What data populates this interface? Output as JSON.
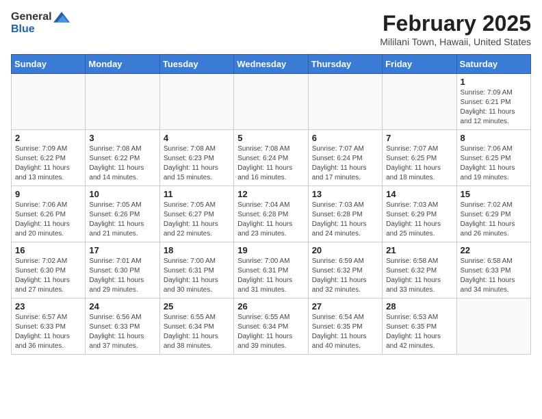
{
  "logo": {
    "general": "General",
    "blue": "Blue"
  },
  "header": {
    "month_year": "February 2025",
    "location": "Mililani Town, Hawaii, United States"
  },
  "days_of_week": [
    "Sunday",
    "Monday",
    "Tuesday",
    "Wednesday",
    "Thursday",
    "Friday",
    "Saturday"
  ],
  "weeks": [
    [
      {
        "day": "",
        "info": ""
      },
      {
        "day": "",
        "info": ""
      },
      {
        "day": "",
        "info": ""
      },
      {
        "day": "",
        "info": ""
      },
      {
        "day": "",
        "info": ""
      },
      {
        "day": "",
        "info": ""
      },
      {
        "day": "1",
        "info": "Sunrise: 7:09 AM\nSunset: 6:21 PM\nDaylight: 11 hours and 12 minutes."
      }
    ],
    [
      {
        "day": "2",
        "info": "Sunrise: 7:09 AM\nSunset: 6:22 PM\nDaylight: 11 hours and 13 minutes."
      },
      {
        "day": "3",
        "info": "Sunrise: 7:08 AM\nSunset: 6:22 PM\nDaylight: 11 hours and 14 minutes."
      },
      {
        "day": "4",
        "info": "Sunrise: 7:08 AM\nSunset: 6:23 PM\nDaylight: 11 hours and 15 minutes."
      },
      {
        "day": "5",
        "info": "Sunrise: 7:08 AM\nSunset: 6:24 PM\nDaylight: 11 hours and 16 minutes."
      },
      {
        "day": "6",
        "info": "Sunrise: 7:07 AM\nSunset: 6:24 PM\nDaylight: 11 hours and 17 minutes."
      },
      {
        "day": "7",
        "info": "Sunrise: 7:07 AM\nSunset: 6:25 PM\nDaylight: 11 hours and 18 minutes."
      },
      {
        "day": "8",
        "info": "Sunrise: 7:06 AM\nSunset: 6:25 PM\nDaylight: 11 hours and 19 minutes."
      }
    ],
    [
      {
        "day": "9",
        "info": "Sunrise: 7:06 AM\nSunset: 6:26 PM\nDaylight: 11 hours and 20 minutes."
      },
      {
        "day": "10",
        "info": "Sunrise: 7:05 AM\nSunset: 6:26 PM\nDaylight: 11 hours and 21 minutes."
      },
      {
        "day": "11",
        "info": "Sunrise: 7:05 AM\nSunset: 6:27 PM\nDaylight: 11 hours and 22 minutes."
      },
      {
        "day": "12",
        "info": "Sunrise: 7:04 AM\nSunset: 6:28 PM\nDaylight: 11 hours and 23 minutes."
      },
      {
        "day": "13",
        "info": "Sunrise: 7:03 AM\nSunset: 6:28 PM\nDaylight: 11 hours and 24 minutes."
      },
      {
        "day": "14",
        "info": "Sunrise: 7:03 AM\nSunset: 6:29 PM\nDaylight: 11 hours and 25 minutes."
      },
      {
        "day": "15",
        "info": "Sunrise: 7:02 AM\nSunset: 6:29 PM\nDaylight: 11 hours and 26 minutes."
      }
    ],
    [
      {
        "day": "16",
        "info": "Sunrise: 7:02 AM\nSunset: 6:30 PM\nDaylight: 11 hours and 27 minutes."
      },
      {
        "day": "17",
        "info": "Sunrise: 7:01 AM\nSunset: 6:30 PM\nDaylight: 11 hours and 29 minutes."
      },
      {
        "day": "18",
        "info": "Sunrise: 7:00 AM\nSunset: 6:31 PM\nDaylight: 11 hours and 30 minutes."
      },
      {
        "day": "19",
        "info": "Sunrise: 7:00 AM\nSunset: 6:31 PM\nDaylight: 11 hours and 31 minutes."
      },
      {
        "day": "20",
        "info": "Sunrise: 6:59 AM\nSunset: 6:32 PM\nDaylight: 11 hours and 32 minutes."
      },
      {
        "day": "21",
        "info": "Sunrise: 6:58 AM\nSunset: 6:32 PM\nDaylight: 11 hours and 33 minutes."
      },
      {
        "day": "22",
        "info": "Sunrise: 6:58 AM\nSunset: 6:33 PM\nDaylight: 11 hours and 34 minutes."
      }
    ],
    [
      {
        "day": "23",
        "info": "Sunrise: 6:57 AM\nSunset: 6:33 PM\nDaylight: 11 hours and 36 minutes."
      },
      {
        "day": "24",
        "info": "Sunrise: 6:56 AM\nSunset: 6:33 PM\nDaylight: 11 hours and 37 minutes."
      },
      {
        "day": "25",
        "info": "Sunrise: 6:55 AM\nSunset: 6:34 PM\nDaylight: 11 hours and 38 minutes."
      },
      {
        "day": "26",
        "info": "Sunrise: 6:55 AM\nSunset: 6:34 PM\nDaylight: 11 hours and 39 minutes."
      },
      {
        "day": "27",
        "info": "Sunrise: 6:54 AM\nSunset: 6:35 PM\nDaylight: 11 hours and 40 minutes."
      },
      {
        "day": "28",
        "info": "Sunrise: 6:53 AM\nSunset: 6:35 PM\nDaylight: 11 hours and 42 minutes."
      },
      {
        "day": "",
        "info": ""
      }
    ]
  ]
}
